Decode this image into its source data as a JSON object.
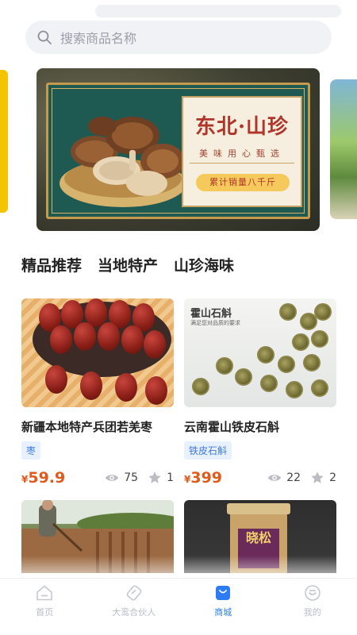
{
  "search": {
    "placeholder": "搜索商品名称"
  },
  "banner": {
    "title": "东北·山珍",
    "subtitle": "美味用心甄选",
    "pill": "累计销量八千斤"
  },
  "tabs": [
    {
      "label": "精品推荐",
      "active": true
    },
    {
      "label": "当地特产",
      "active": false
    },
    {
      "label": "山珍海味",
      "active": false
    }
  ],
  "products": [
    {
      "name": "新疆本地特产兵团若羌枣",
      "tag": "枣",
      "currency": "¥",
      "price": "59.9",
      "views": "75",
      "stars": "1"
    },
    {
      "name": "云南霍山铁皮石斛",
      "tag": "铁皮石斛",
      "currency": "¥",
      "price": "399",
      "views": "22",
      "stars": "2",
      "image_text": "霍山石斛",
      "image_subtext": "满足您对品质的要求"
    }
  ],
  "third_image_text": "晓松",
  "tabbar": {
    "items": [
      {
        "label": "首页",
        "icon": "home-icon",
        "active": false
      },
      {
        "label": "大鸾合伙人",
        "icon": "partner-icon",
        "active": false
      },
      {
        "label": "商城",
        "icon": "shop-icon",
        "active": true
      },
      {
        "label": "我的",
        "icon": "profile-icon",
        "active": false
      }
    ]
  },
  "colors": {
    "accent": "#2d7cf6",
    "price": "#e05a1c",
    "tag_bg": "#e8f1ff",
    "tab_underline": "#bcd2f5"
  }
}
